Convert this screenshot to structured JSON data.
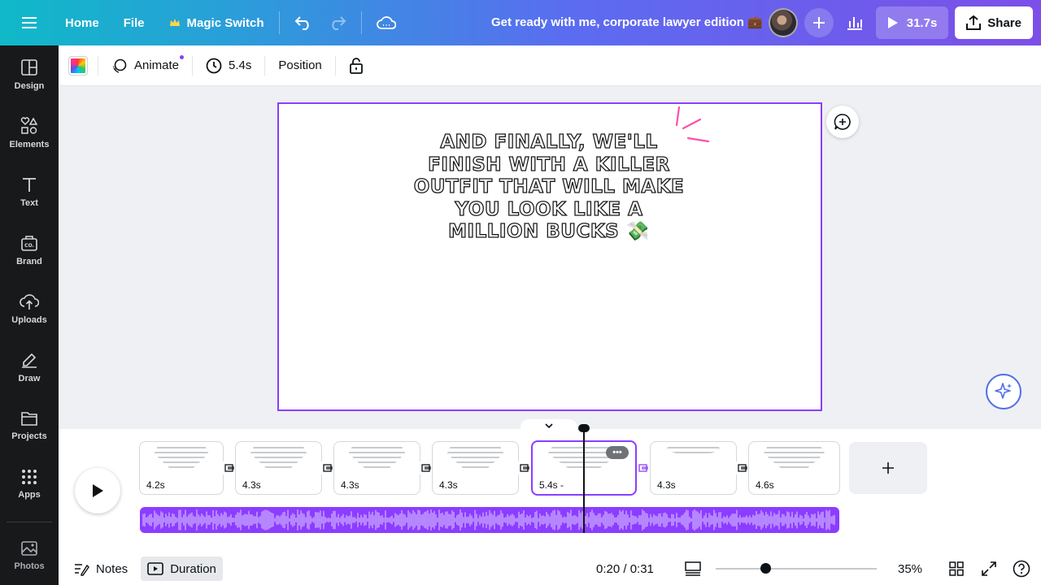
{
  "topbar": {
    "home": "Home",
    "file": "File",
    "magic_switch": "Magic Switch",
    "title": "Get ready with me, corporate lawyer edition 💼",
    "play_duration": "31.7s",
    "share": "Share"
  },
  "sidebar": {
    "items": [
      {
        "label": "Design",
        "icon": "design-icon"
      },
      {
        "label": "Elements",
        "icon": "elements-icon"
      },
      {
        "label": "Text",
        "icon": "text-icon"
      },
      {
        "label": "Brand",
        "icon": "brand-icon"
      },
      {
        "label": "Uploads",
        "icon": "uploads-icon"
      },
      {
        "label": "Draw",
        "icon": "draw-icon"
      },
      {
        "label": "Projects",
        "icon": "projects-icon"
      },
      {
        "label": "Apps",
        "icon": "apps-icon"
      },
      {
        "label": "Photos",
        "icon": "photos-icon"
      }
    ]
  },
  "toolbar": {
    "animate": "Animate",
    "duration": "5.4s",
    "position": "Position"
  },
  "canvas": {
    "headline": "And finally, we'll finish with a killer outfit that will make you look like a million bucks 💸"
  },
  "timeline": {
    "clips": [
      {
        "duration": "4.2s"
      },
      {
        "duration": "4.3s"
      },
      {
        "duration": "4.3s"
      },
      {
        "duration": "4.3s"
      },
      {
        "duration": "5.4s -",
        "active": true
      },
      {
        "duration": "4.3s"
      },
      {
        "duration": "4.6s"
      }
    ]
  },
  "bottombar": {
    "notes": "Notes",
    "duration": "Duration",
    "time": "0:20 / 0:31",
    "zoom": "35%"
  },
  "colors": {
    "accent": "#8b3dff",
    "sidebar_bg": "#18191b",
    "header_gradient_start": "#0fb9c8",
    "header_gradient_end": "#7c4fe8",
    "sparkle": "#ff4fa8"
  }
}
